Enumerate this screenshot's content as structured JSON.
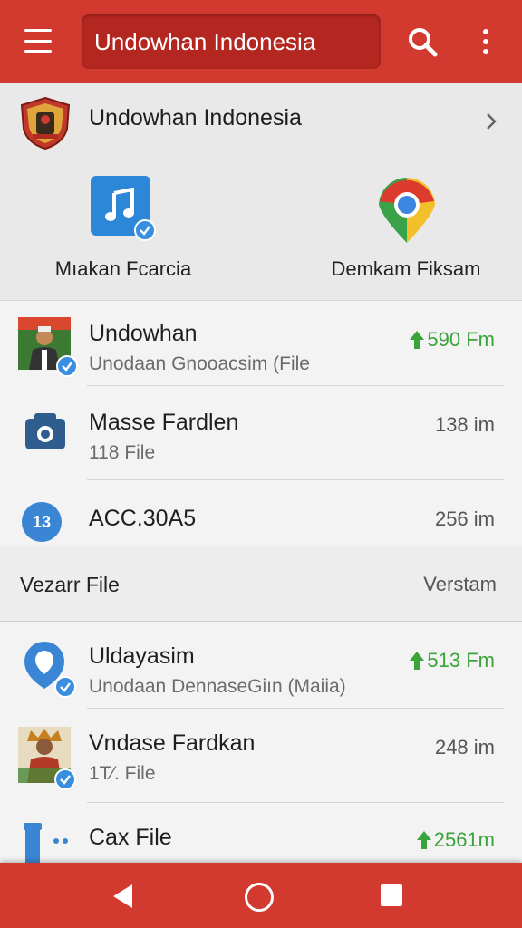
{
  "appbar": {
    "title": "Undowhan Indonesia",
    "menu_icon": "hamburger-menu-icon",
    "search_icon": "search-icon",
    "more_icon": "more-vert-icon",
    "color": "#d23a2f"
  },
  "header": {
    "title": "Undowhan Indonesia",
    "shortcuts": [
      {
        "label": "Mıakan Fcarcia",
        "icon": "music-app-icon"
      },
      {
        "label": "Demkam Fiksam",
        "icon": "chrome-icon"
      }
    ]
  },
  "files": [
    {
      "name": "Undowhan",
      "sub": "Unodaan Gnooacsim (File",
      "size": "590 Fm",
      "trend": "up",
      "icon": "person-thumbnail"
    },
    {
      "name": "Masse Fardlen",
      "sub": "118 File",
      "size": "138 im",
      "icon": "camera-icon"
    },
    {
      "name": "ACC.30A5",
      "sub": "",
      "size": "256 im",
      "icon": "counter-badge-icon",
      "icon_text": "13"
    }
  ],
  "section": {
    "left": "Vezarr File",
    "right": "Verstam"
  },
  "files2": [
    {
      "name": "Uldayasim",
      "sub": "Unodaan DennaseGiın (Maiia)",
      "size": "513 Fm",
      "trend": "up",
      "icon": "location-pin-icon"
    },
    {
      "name": "Vndase Fardkan",
      "sub": "1T⁄. File",
      "size": "248 im",
      "icon": "person-thumbnail"
    },
    {
      "name": "Cax File",
      "sub": "",
      "size": "2561m",
      "trend": "up",
      "icon": "bottle-icon"
    }
  ],
  "navbar": {
    "back_icon": "back-icon",
    "home_icon": "home-icon",
    "recent_icon": "recent-apps-icon"
  },
  "colors": {
    "accent": "#d23a2f",
    "trend_up": "#3aa33a",
    "check_badge": "#3a8ee0"
  }
}
